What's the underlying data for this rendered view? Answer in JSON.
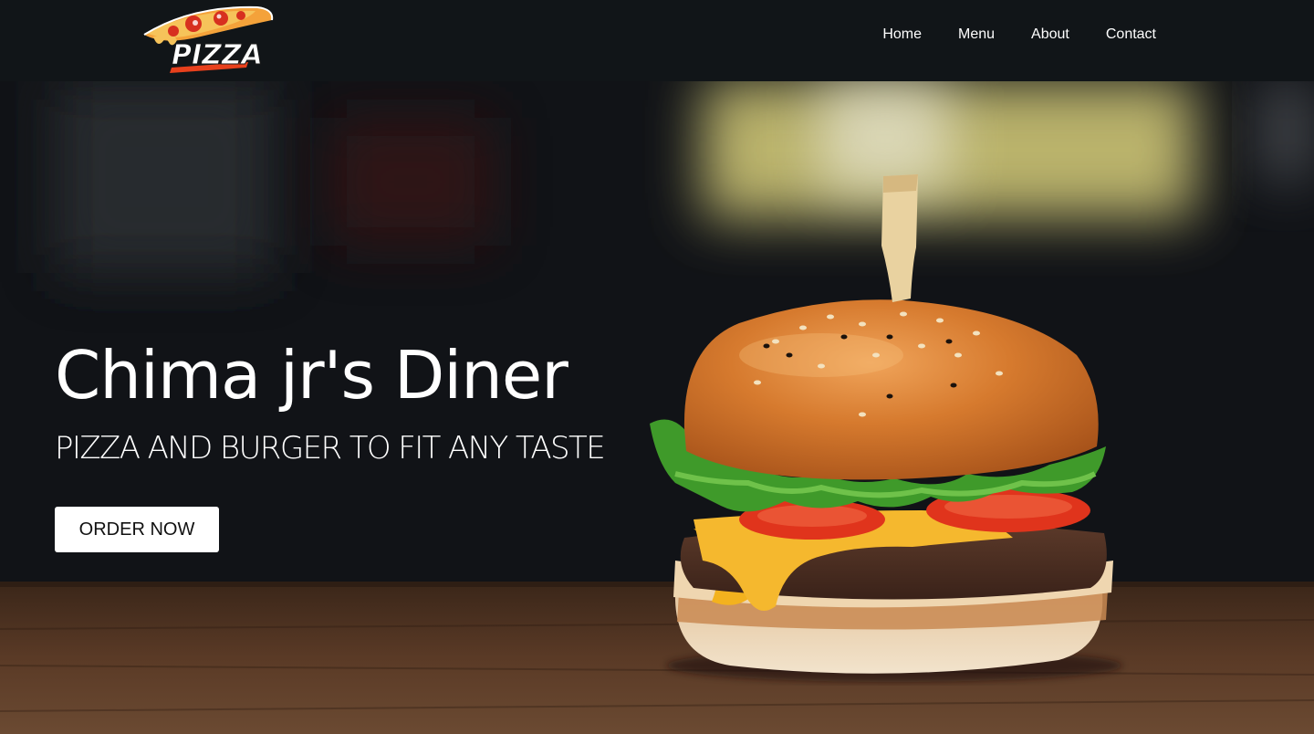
{
  "brand": {
    "logo_text": "PIZZA",
    "logo_icon": "pizza-slice-icon"
  },
  "nav": {
    "items": [
      {
        "label": "Home"
      },
      {
        "label": "Menu"
      },
      {
        "label": "About"
      },
      {
        "label": "Contact"
      }
    ]
  },
  "hero": {
    "title": "Chima jr's Diner",
    "subtitle": "PIZZA AND BURGER TO FIT ANY TASTE",
    "cta_label": "ORDER NOW",
    "image": "burger-photo"
  },
  "colors": {
    "nav_bg": "#111518",
    "text": "#ffffff",
    "button_bg": "#ffffff",
    "button_text": "#111111",
    "logo_accent": "#e8401c"
  }
}
